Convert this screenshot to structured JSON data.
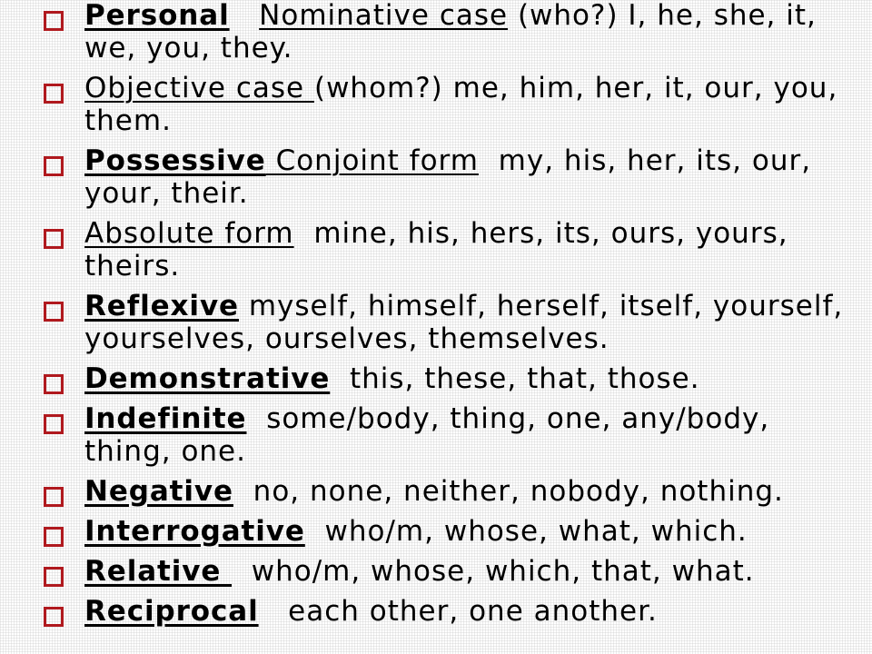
{
  "colors": {
    "bullet": "#b0191e",
    "text": "#000000"
  },
  "bullet_icon": "hollow-square-icon",
  "items": [
    {
      "name": "personal",
      "lines": [
        [
          {
            "t": "Personal",
            "bold": true,
            "u": true
          },
          {
            "t": "   ",
            "bold": false,
            "u": false
          },
          {
            "t": "Nominative case",
            "bold": false,
            "u": true
          },
          {
            "t": " (who?) I, he, she, it,",
            "bold": false,
            "u": false
          }
        ],
        [
          {
            "t": "we, you, they.",
            "bold": false,
            "u": false
          }
        ]
      ]
    },
    {
      "name": "objective",
      "lines": [
        [
          {
            "t": "Objective case ",
            "bold": false,
            "u": true
          },
          {
            "t": "(whom?) me, him, her, it, our, you,",
            "bold": false,
            "u": false
          }
        ],
        [
          {
            "t": "them.",
            "bold": false,
            "u": false
          }
        ]
      ]
    },
    {
      "name": "possessive",
      "lines": [
        [
          {
            "t": "Possessive",
            "bold": true,
            "u": true
          },
          {
            "t": " Conjoint form",
            "bold": false,
            "u": true
          },
          {
            "t": "  my, his, her, its, our,",
            "bold": false,
            "u": false
          }
        ],
        [
          {
            "t": "your, their.",
            "bold": false,
            "u": false
          }
        ]
      ]
    },
    {
      "name": "absolute",
      "lines": [
        [
          {
            "t": "Absolute form",
            "bold": false,
            "u": true
          },
          {
            "t": "  mine, his, hers, its, ours, yours,",
            "bold": false,
            "u": false
          }
        ],
        [
          {
            "t": "theirs.",
            "bold": false,
            "u": false
          }
        ]
      ]
    },
    {
      "name": "reflexive",
      "lines": [
        [
          {
            "t": "Reflexive",
            "bold": true,
            "u": true
          },
          {
            "t": " myself, himself, herself, itself, yourself,",
            "bold": false,
            "u": false
          }
        ],
        [
          {
            "t": "yourselves, ourselves, themselves.",
            "bold": false,
            "u": false
          }
        ]
      ]
    },
    {
      "name": "demonstrative",
      "lines": [
        [
          {
            "t": "Demonstrative",
            "bold": true,
            "u": true
          },
          {
            "t": "  this, these, that, those.",
            "bold": false,
            "u": false
          }
        ]
      ]
    },
    {
      "name": "indefinite",
      "lines": [
        [
          {
            "t": "Indefinite",
            "bold": true,
            "u": true
          },
          {
            "t": "  some/body, thing, one, any/body,",
            "bold": false,
            "u": false
          }
        ],
        [
          {
            "t": "thing, one.",
            "bold": false,
            "u": false
          }
        ]
      ]
    },
    {
      "name": "negative",
      "lines": [
        [
          {
            "t": "Negative",
            "bold": true,
            "u": true
          },
          {
            "t": "  no, none, neither, nobody, nothing.",
            "bold": false,
            "u": false
          }
        ]
      ]
    },
    {
      "name": "interrogative",
      "lines": [
        [
          {
            "t": "Interrogative",
            "bold": true,
            "u": true
          },
          {
            "t": "  who/m, whose, what, which.",
            "bold": false,
            "u": false
          }
        ]
      ]
    },
    {
      "name": "relative",
      "lines": [
        [
          {
            "t": "Relative ",
            "bold": true,
            "u": true
          },
          {
            "t": "  who/m, whose, which, that, what.",
            "bold": false,
            "u": false
          }
        ]
      ]
    },
    {
      "name": "reciprocal",
      "lines": [
        [
          {
            "t": "Reciprocal",
            "bold": true,
            "u": true
          },
          {
            "t": "   each other, one another.",
            "bold": false,
            "u": false
          }
        ]
      ]
    }
  ]
}
